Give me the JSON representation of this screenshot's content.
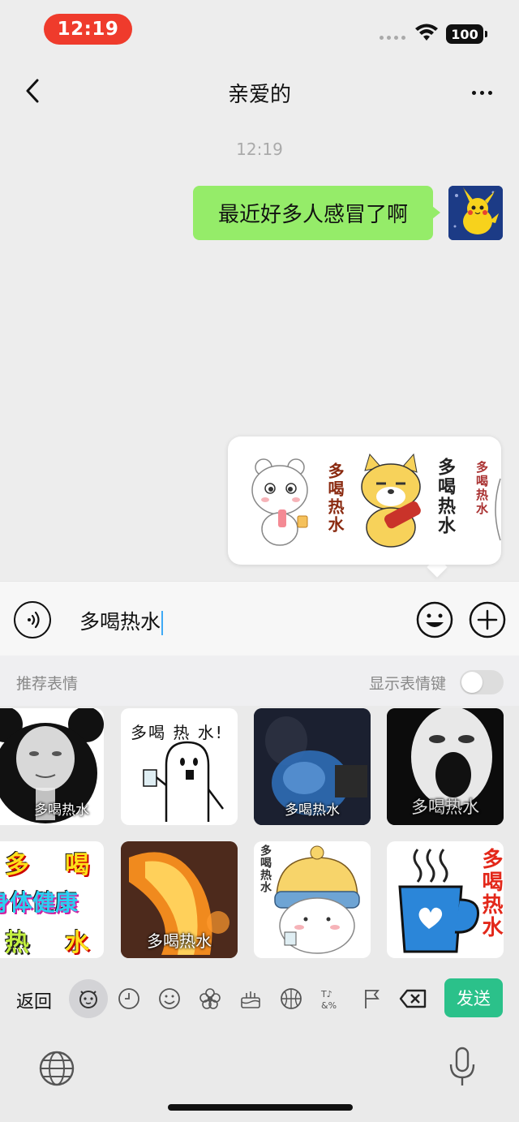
{
  "status_bar": {
    "time": "12:19",
    "battery": "100"
  },
  "nav": {
    "title": "亲爱的",
    "back_icon": "chevron-left-icon",
    "more_icon": "more-dots-icon"
  },
  "chat": {
    "timestamp": "12:19",
    "messages": [
      {
        "sender": "me",
        "text": "最近好多人感冒了啊"
      }
    ]
  },
  "suggestion": {
    "stickers": [
      {
        "text": "多喝热水"
      },
      {
        "text": "多喝热水"
      },
      {
        "text": "多喝热水"
      }
    ]
  },
  "input": {
    "value": "多喝热水"
  },
  "panel": {
    "label": "推荐表情",
    "toggle_label": "显示表情键",
    "toggle_on": false,
    "stickers": [
      {
        "caption": "多喝热水"
      },
      {
        "caption": "多喝 热 水!"
      },
      {
        "caption": "多喝热水"
      },
      {
        "caption": "多喝热水"
      },
      {
        "lines": [
          "多",
          "喝",
          "身体健康",
          "热",
          "水"
        ]
      },
      {
        "caption": "多喝热水"
      },
      {
        "caption": "多喝热水"
      },
      {
        "caption": "多喝热水"
      }
    ]
  },
  "toolbar": {
    "back_label": "返回",
    "send_label": "发送",
    "icons": [
      "sticker-face-icon",
      "recent-clock-icon",
      "smiley-icon",
      "flower-icon",
      "cake-icon",
      "basketball-icon",
      "symbols-icon",
      "flag-icon",
      "backspace-icon"
    ]
  },
  "colors": {
    "bubble": "#95ec69",
    "send": "#2bc18a",
    "time_pill": "#ef3b2c"
  }
}
